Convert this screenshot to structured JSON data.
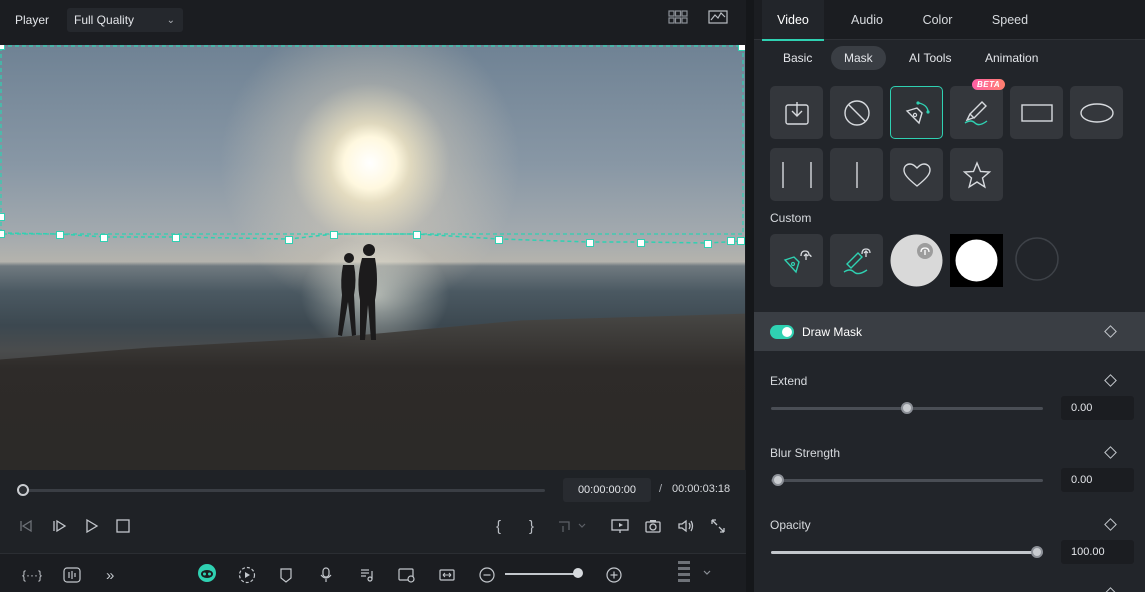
{
  "player": {
    "label": "Player",
    "quality": "Full Quality",
    "time_current": "00:00:00:00",
    "time_separator": "/",
    "time_total": "00:00:03:18",
    "progress": 0.0
  },
  "inspector": {
    "tabs": [
      "Video",
      "Audio",
      "Color",
      "Speed"
    ],
    "active_tab": "Video",
    "subtabs": [
      "Basic",
      "Mask",
      "AI Tools",
      "Animation"
    ],
    "active_subtab": "Mask",
    "beta_badge": "BETA",
    "custom_label": "Custom",
    "draw_mask_label": "Draw Mask",
    "draw_mask_enabled": true,
    "extend": {
      "label": "Extend",
      "value": "0.00",
      "level": 0.5
    },
    "blur": {
      "label": "Blur Strength",
      "value": "0.00",
      "level": 0.0
    },
    "opacity": {
      "label": "Opacity",
      "value": "100.00",
      "level": 1.0
    }
  },
  "colors": {
    "accent": "#2fd1b2",
    "panel": "#22252a",
    "background": "#1b1d21"
  },
  "icons": {
    "mask_presets": [
      "import-icon",
      "none-icon",
      "pen-mask-icon",
      "brush-mask-icon",
      "rectangle-icon",
      "ellipse-icon",
      "double-line-icon",
      "single-line-icon",
      "heart-icon",
      "star-icon"
    ],
    "player_controls": [
      "prev-frame-icon",
      "play-step-icon",
      "play-icon",
      "stop-icon",
      "mark-in-icon",
      "mark-out-icon",
      "clip-icon",
      "display-icon",
      "snapshot-icon",
      "volume-icon",
      "fullscreen-icon"
    ],
    "toolbar": [
      "more-tools-icon",
      "audio-wave-icon",
      "expand-icon",
      "ai-face-icon",
      "auto-play-icon",
      "marker-icon",
      "mic-icon",
      "music-note-icon",
      "voiceover-icon",
      "fit-icon",
      "zoom-out-icon",
      "zoom-in-icon",
      "grid-menu-icon"
    ]
  }
}
